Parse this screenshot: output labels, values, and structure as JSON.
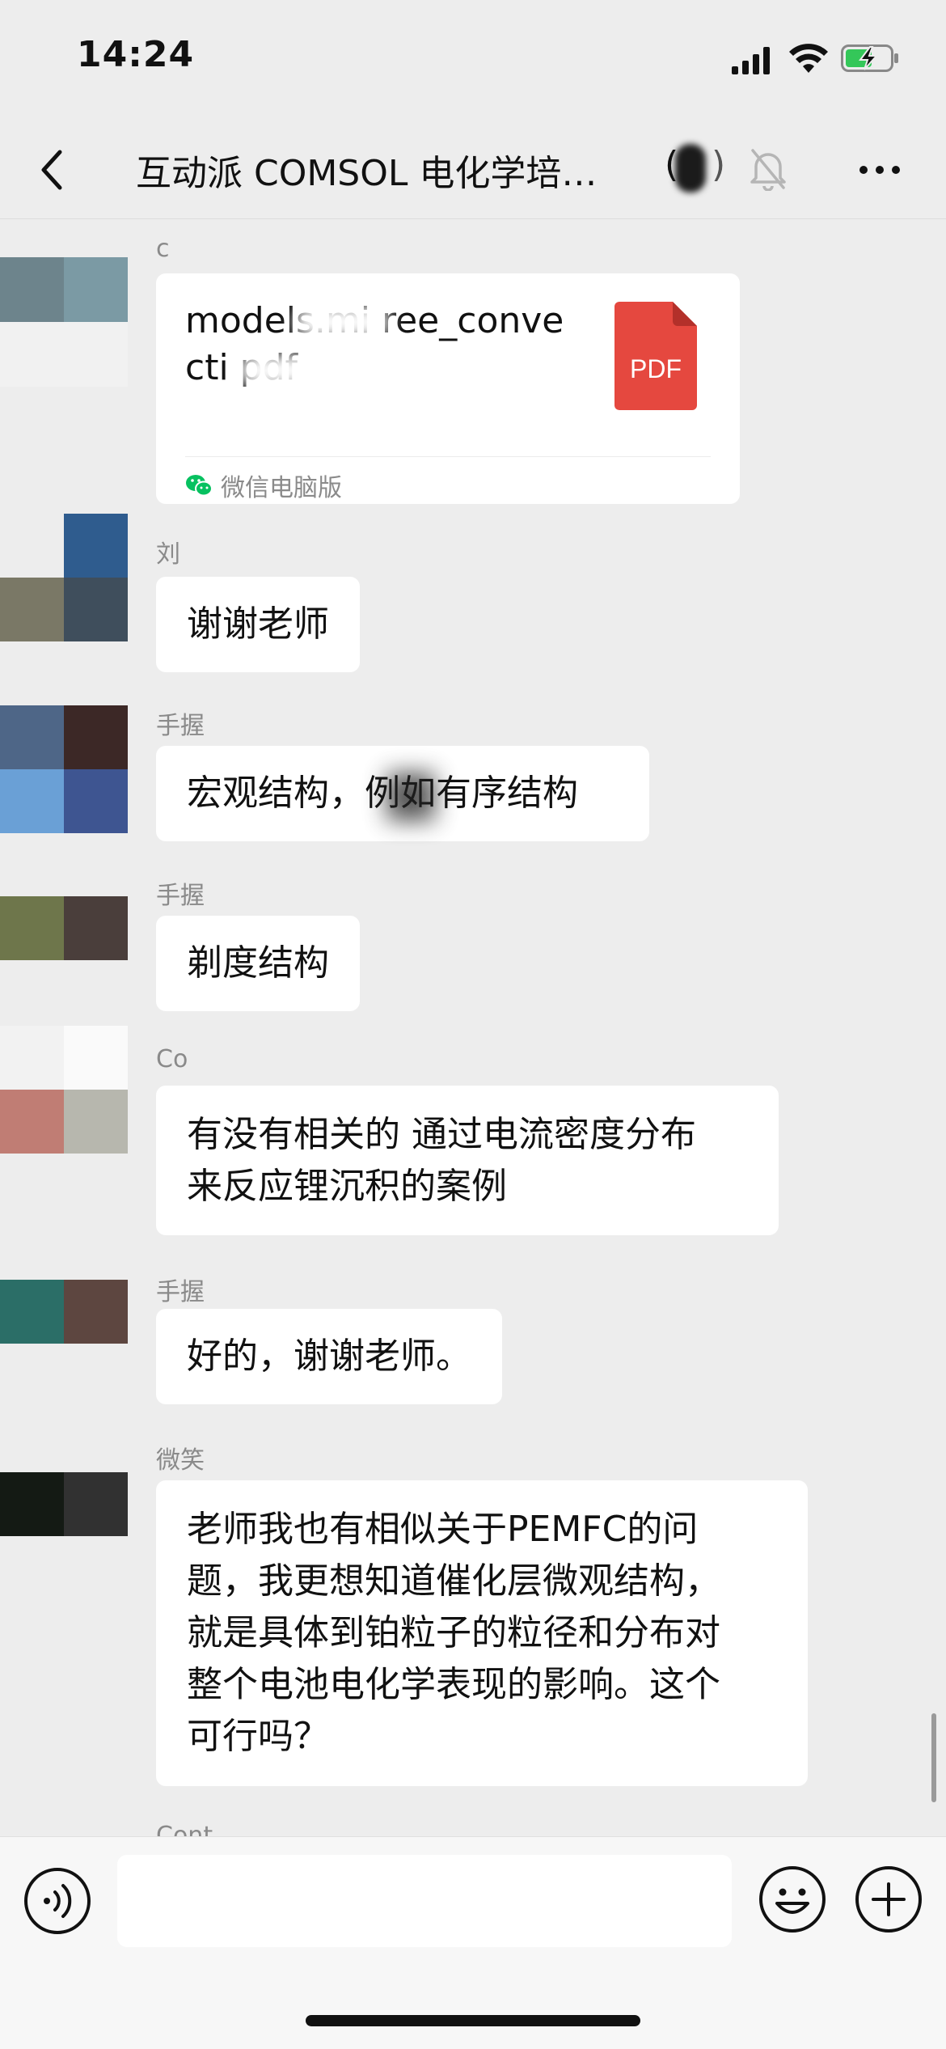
{
  "status_bar": {
    "time": "14:24"
  },
  "header": {
    "title": "互动派 COMSOL 电化学培…",
    "member_count_open": "(",
    "member_count_close": ")"
  },
  "messages": [
    {
      "sender": "c",
      "type": "file",
      "file_name": "models.mi  ree_conve cti   pdf",
      "file_type": "PDF",
      "source": "微信电脑版",
      "avatar_colors": [
        "#6d848c",
        "#7b9aa4",
        "#f1f1f1",
        "#f1f1f1"
      ]
    },
    {
      "sender": "刘",
      "type": "text",
      "lines": [
        "谢谢老师"
      ],
      "avatar_colors": [
        "#ededed",
        "#2f5c8e",
        "#7a7866",
        "#3f4e5c"
      ]
    },
    {
      "sender": "手握",
      "type": "text",
      "lines": [
        "宏观结构，例如有序结构"
      ],
      "avatar_colors": [
        "#4e6687",
        "#3c2826",
        "#6aa0d6",
        "#3e5591"
      ]
    },
    {
      "sender": "手握",
      "type": "text",
      "lines": [
        "剃度结构"
      ],
      "avatar_colors": [
        "#6e764b",
        "#4a3e3b",
        "#ededed",
        "#ededed"
      ]
    },
    {
      "sender": "Co",
      "type": "text",
      "lines": [
        "有没有相关的 通过电流密度分布",
        "来反应锂沉积的案例"
      ],
      "avatar_colors": [
        "#f2f2f2",
        "#fafafa",
        "#c07d74",
        "#b7b7ae"
      ]
    },
    {
      "sender": "手握",
      "type": "text",
      "lines": [
        "好的，谢谢老师。"
      ],
      "avatar_colors": [
        "#2b6e67",
        "#5d4640",
        "#ededed",
        "#ededed"
      ]
    },
    {
      "sender": "微笑",
      "type": "text",
      "lines": [
        "老师我也有相似关于PEMFC的问",
        "题，我更想知道催化层微观结构，",
        "就是具体到铂粒子的粒径和分布对",
        "整个电池电化学表现的影响。这个",
        "可行吗？"
      ],
      "avatar_colors": [
        "#141a14",
        "#313131",
        "#ededed",
        "#ededed"
      ]
    },
    {
      "sender": "Cont",
      "type": "partial"
    }
  ],
  "input_bar": {
    "placeholder": ""
  },
  "colors": {
    "background": "#ededed",
    "bubble": "#ffffff",
    "pdf_red": "#e5483f",
    "wechat_green": "#07c160"
  }
}
